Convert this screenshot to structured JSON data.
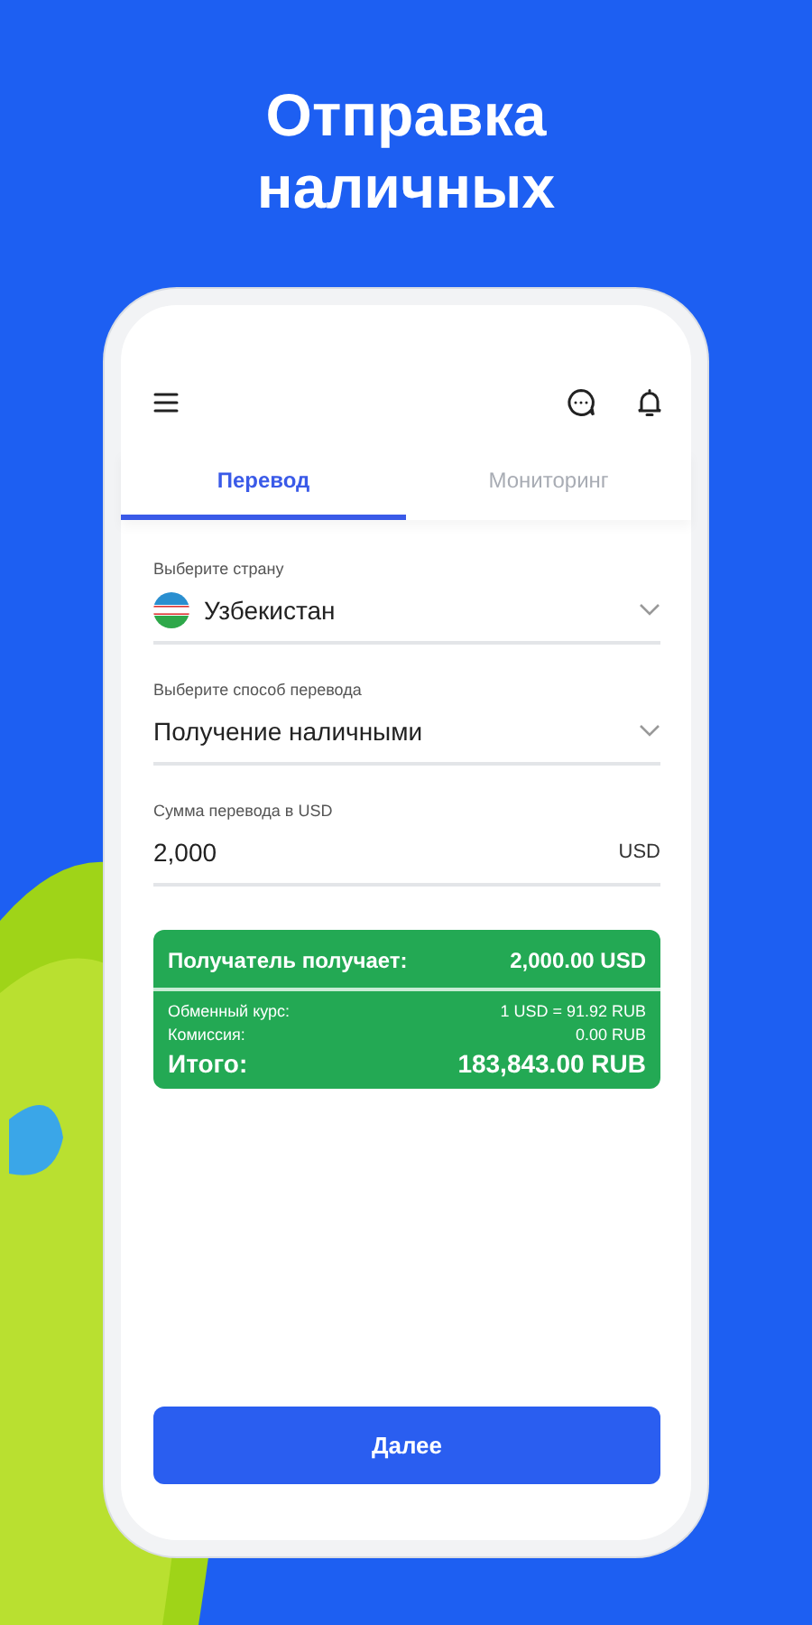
{
  "headline": "Отправка наличных",
  "tabs": [
    {
      "label": "Перевод",
      "selected": true
    },
    {
      "label": "Мониторинг",
      "selected": false
    }
  ],
  "fields": [
    {
      "kind": "country",
      "label": "Выберите страну",
      "value": "Узбекистан"
    },
    {
      "kind": "select",
      "label": "Выберите способ перевода",
      "value": "Получение наличными"
    },
    {
      "kind": "amount",
      "label": "Сумма перевода в USD",
      "value": "2,000",
      "suffix": "USD"
    }
  ],
  "summary": {
    "receiver_label": "Получатель получает:",
    "receiver_value": "2,000.00 USD",
    "rows": [
      {
        "label": "Обменный курс:",
        "value": "1 USD = 91.92 RUB"
      },
      {
        "label": "Комиссия:",
        "value": "0.00 RUB"
      }
    ],
    "total_label": "Итого:",
    "total_value": "183,843.00 RUB"
  },
  "button": "Далее"
}
